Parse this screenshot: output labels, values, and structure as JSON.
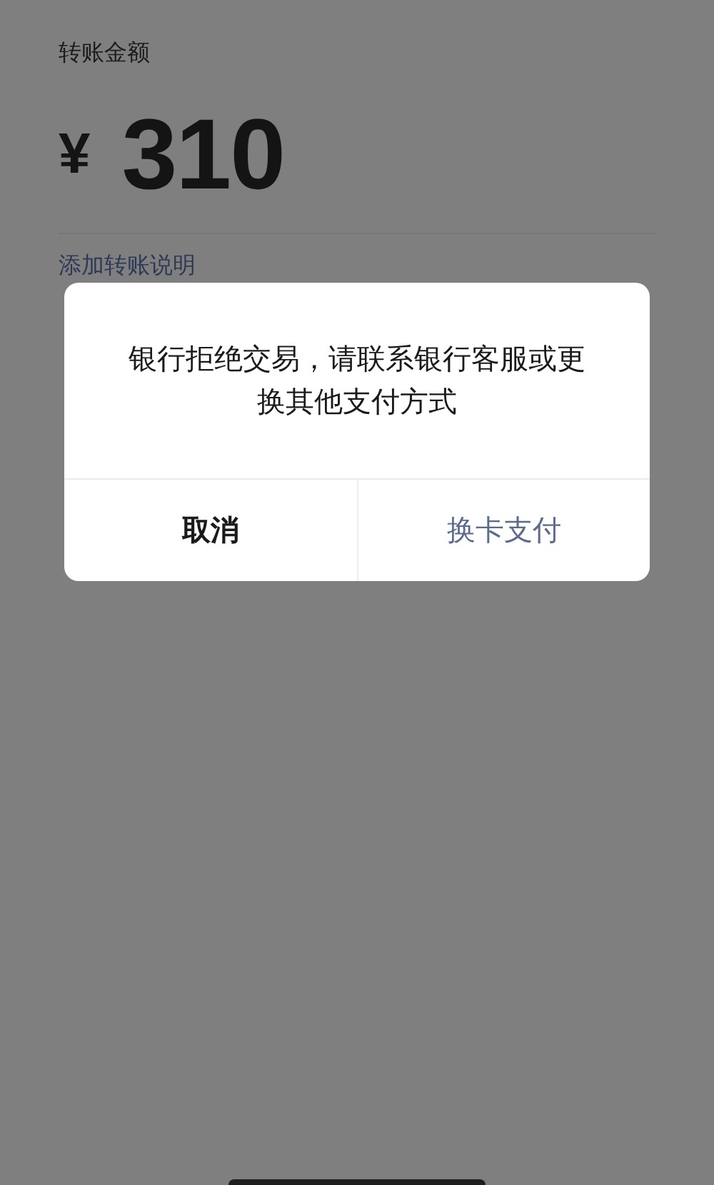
{
  "page": {
    "amount_label": "转账金额",
    "currency": "¥",
    "amount": "310",
    "note_link": "添加转账说明"
  },
  "dialog": {
    "message": "银行拒绝交易，请联系银行客服或更换其他支付方式",
    "buttons": [
      {
        "label": "取消",
        "kind": "cancel"
      },
      {
        "label": "换卡支付",
        "kind": "primary"
      }
    ]
  }
}
